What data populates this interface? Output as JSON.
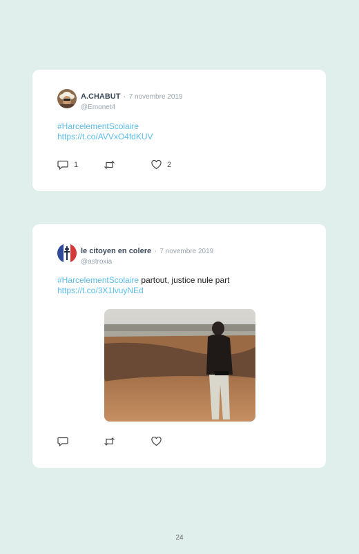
{
  "tweets": [
    {
      "author": "A.CHABUT",
      "separator": "·",
      "date": "7 novembre 2019",
      "handle": "@Emonet4",
      "hashtag": "#HarcelementScolaire",
      "text": "",
      "link": "https://t.co/AVVxO4fdKUV",
      "reply_count": "1",
      "like_count": "2"
    },
    {
      "author": "le citoyen en colere",
      "separator": "·",
      "date": "7 novembre 2019",
      "handle": "@astroxia",
      "hashtag": "#HarcelementScolaire",
      "text": " partout, justice nule part",
      "link": "https://t.co/3X1lvuyNEd"
    }
  ],
  "icons": {
    "reply": "reply-icon",
    "retweet": "retweet-icon",
    "like": "heart-icon"
  },
  "colors": {
    "background": "#e0efec",
    "card": "#ffffff",
    "link": "#5bbde8"
  },
  "page_number": "24"
}
